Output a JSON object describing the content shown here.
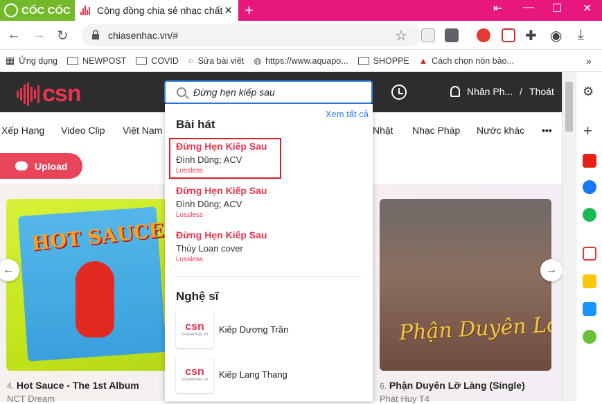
{
  "browser": {
    "brand": "CỐC CỐC",
    "tab_title": "Cộng đồng chia sẻ nhạc chất",
    "url": "chiasenhac.vn/#",
    "bookmarks": [
      {
        "label": "Ứng dụng",
        "icon": "apps-icon"
      },
      {
        "label": "NEWPOST",
        "icon": "folder-icon"
      },
      {
        "label": "COVID",
        "icon": "folder-icon"
      },
      {
        "label": "Sửa bài viết",
        "icon": "site-icon"
      },
      {
        "label": "https://www.aquapo...",
        "icon": "globe-icon"
      },
      {
        "label": "SHOPPE",
        "icon": "folder-icon"
      },
      {
        "label": "Cách chọn nón bảo...",
        "icon": "site-icon"
      }
    ],
    "more": "»"
  },
  "site": {
    "logo": "csn",
    "search_value": "Đừng hẹn kiếp sau",
    "user_name": "Nhân Ph...",
    "separator": "/",
    "logout": "Thoát",
    "menu": [
      "Xếp Hạng",
      "Video Clip",
      "Việt Nam",
      "Nhật",
      "Nhạc Pháp",
      "Nước khác",
      "•••"
    ],
    "upload_label": "Upload"
  },
  "dropdown": {
    "see_all": "Xem tất cả",
    "songs_heading": "Bài hát",
    "songs": [
      {
        "title": "Đừng Hẹn Kiếp Sau",
        "artist": "Đình Dũng; ACV",
        "quality": "Lossless"
      },
      {
        "title": "Đừng Hẹn Kiếp Sau",
        "artist": "Đình Dũng; ACV",
        "quality": "Lossless"
      },
      {
        "title": "Đừng Hẹn Kiếp Sau",
        "artist": "Thúy Loan cover",
        "quality": "Lossless"
      }
    ],
    "artists_heading": "Nghệ sĩ",
    "artists": [
      {
        "name": "Kiếp Dương Trần",
        "thumb": "csn",
        "thumb_sub": "chiasenhac.vn"
      },
      {
        "name": "Kiếp Lang Thang",
        "thumb": "csn",
        "thumb_sub": "chiasenhac.vn"
      }
    ]
  },
  "albums": [
    {
      "num": "4.",
      "title": "Hot Sauce - The 1st Album",
      "artist": "NCT Dream",
      "art_text": "HOT SAUCE"
    },
    {
      "num": "6.",
      "title": "Phận Duyên Lỡ Làng (Single)",
      "artist": "Phát Huy T4",
      "art_text": "Phận Duyên Lỡ Làng"
    }
  ],
  "colors": {
    "brand_pink": "#e8177d",
    "brand_green": "#73b92a",
    "accent_red": "#e8344e",
    "link_blue": "#2b7de9"
  }
}
